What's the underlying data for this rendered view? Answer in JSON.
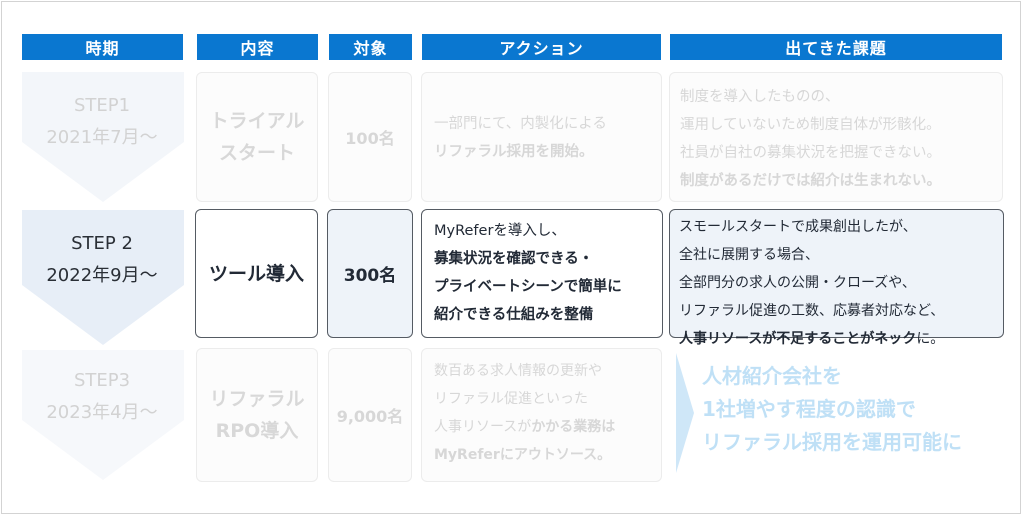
{
  "headers": {
    "period": "時期",
    "content": "内容",
    "target": "対象",
    "action": "アクション",
    "issues": "出てきた課題"
  },
  "rows": [
    {
      "step_line1": "STEP1",
      "step_line2": "2021年7月～",
      "content_line1": "トライアル",
      "content_line2": "スタート",
      "target": "100名",
      "action_lines": [
        "一部門にて、内製化による",
        "リファラル採用を開始。"
      ],
      "issue_lines": [
        "制度を導入したものの、",
        "運用していないため制度自体が形骸化。",
        "社員が自社の募集状況を把握できない。",
        "制度があるだけでは紹介は生まれない。"
      ]
    },
    {
      "step_line1": "STEP 2",
      "step_line2": "2022年9月～",
      "content_line1": "ツール導入",
      "target": "300名",
      "action_lines": [
        "MyReferを導入し、",
        "募集状況を確認できる・",
        "プライベートシーンで簡単に",
        "紹介できる仕組みを整備"
      ],
      "issue_lines": [
        "スモールスタートで成果創出したが、",
        "全社に展開する場合、",
        "全部門分の求人の公開・クローズや、",
        "リファラル促進の工数、応募者対応など、"
      ],
      "issue_last_bold": "人事リソースが不足することがネック",
      "issue_last_tail": "に。"
    },
    {
      "step_line1": "STEP3",
      "step_line2": "2023年4月～",
      "content_line1": "リファラル",
      "content_line2": "RPO導入",
      "target": "9,000名",
      "action_lines": [
        "数百ある求人情報の更新や",
        "リファラル促進といった"
      ],
      "action_line3_pre": "人事リソースが",
      "action_line3_bold": "かかる業務は",
      "action_line4": "MyReferにアウトソース。"
    }
  ],
  "callout_lines": [
    "人材紹介会社を",
    "1社増やす程度の認識で",
    "リファラル採用を運用可能に"
  ],
  "colors": {
    "header_bg": "#0a77d0",
    "chevron_active": "#e8eef7",
    "chevron_faded": "#f2f5f9",
    "callout": "#bfe0f6"
  }
}
